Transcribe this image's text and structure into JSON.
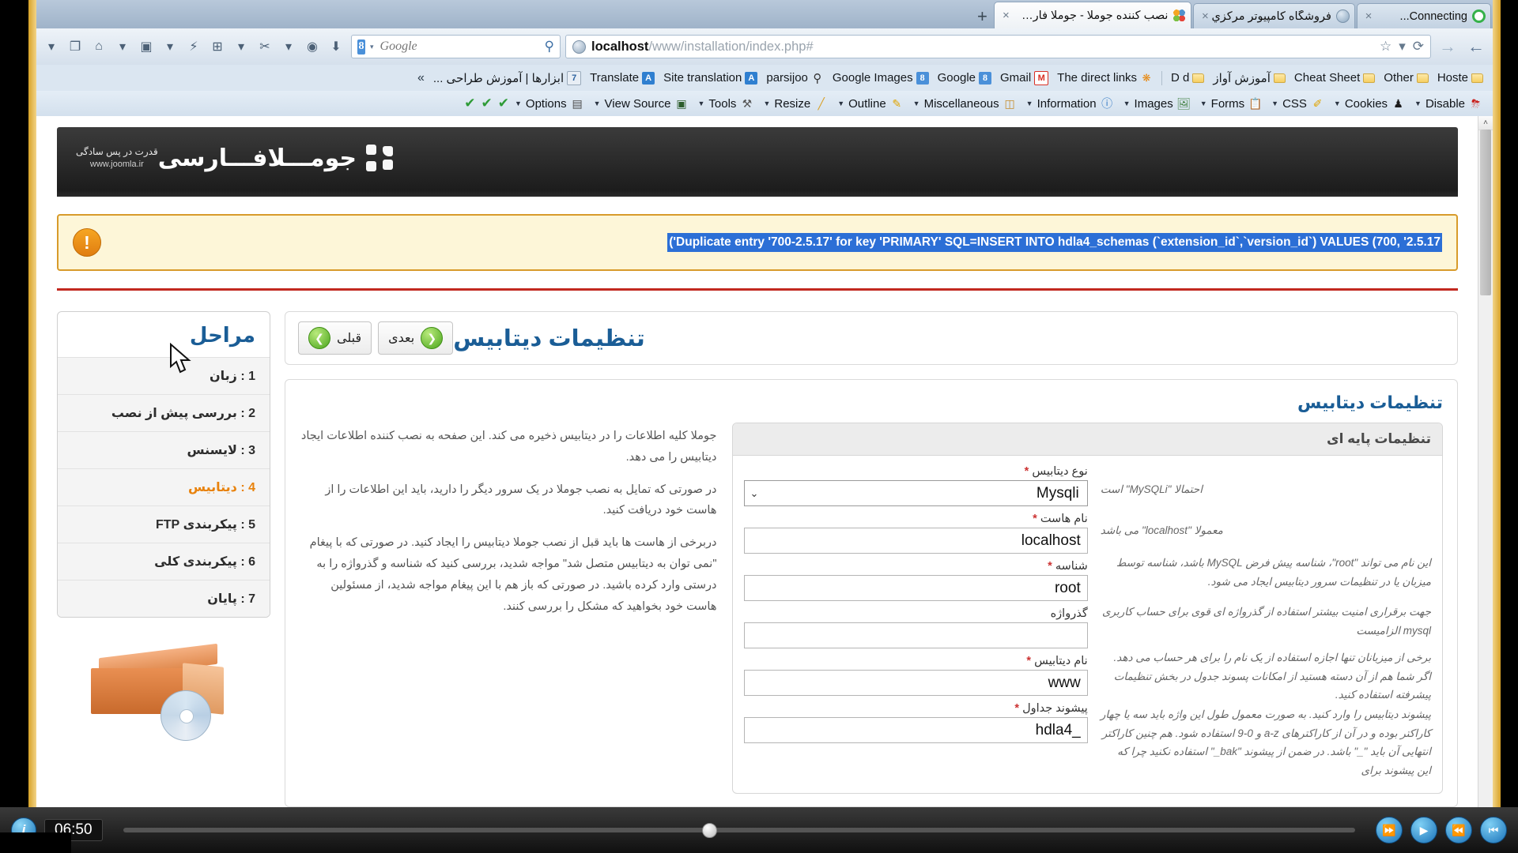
{
  "browser": {
    "tabs": [
      {
        "title": "Connecting...",
        "favicon": "loading-ring-icon",
        "active": false,
        "close": "×"
      },
      {
        "title": "فروشگاه کامپیوتر مرکزي",
        "favicon": "globe-icon",
        "active": false,
        "close": "×"
      },
      {
        "title": "نصب کننده جوملا - جوملا فارس...",
        "favicon": "joomla-icon",
        "active": true,
        "close": "×"
      }
    ],
    "new_tab_label": "+",
    "nav": {
      "back": "←",
      "forward": "→",
      "url_host": "localhost",
      "url_path": "/www/installation/index.php#",
      "bookmark_star": "☆",
      "bookmark_caret": "▾",
      "reload": "⟳",
      "search_engine": "8",
      "search_engine_caret": "▾",
      "search_placeholder": "Google",
      "search_icon": "⚲",
      "download_icon": "⬇",
      "globe_icon": "◉",
      "home_icon": "⌂",
      "toolbar_icons": [
        "▾",
        "✂",
        "▾",
        "⊞",
        "⚡",
        "▾",
        "▣",
        "▾",
        "⌂",
        "❐",
        "▾"
      ]
    },
    "bookmarks": [
      {
        "label": "Hoste",
        "icon": "folder-icon"
      },
      {
        "label": "Other",
        "icon": "folder-icon"
      },
      {
        "label": "Cheat Sheet",
        "icon": "folder-icon"
      },
      {
        "label": "آموزش آواز",
        "icon": "folder-icon"
      },
      {
        "label": "D d",
        "icon": "folder-icon"
      },
      {
        "label": "The direct links",
        "icon": "dots-icon"
      },
      {
        "label": "Gmail",
        "icon": "gmail-icon"
      },
      {
        "label": "Google",
        "icon": "google-icon"
      },
      {
        "label": "Google Images",
        "icon": "google-icon"
      },
      {
        "label": "parsijoo",
        "icon": "search-icon"
      },
      {
        "label": "Site translation",
        "icon": "translate-icon"
      },
      {
        "label": "Translate",
        "icon": "translate-icon"
      },
      {
        "label": "ابزارها | آموزش طراحی ...",
        "icon": "seven-icon"
      }
    ],
    "bookmarks_overflow": "»",
    "webdev_toolbar": [
      {
        "label": "Disable",
        "icon": "disable-icon",
        "glyph": "⊘"
      },
      {
        "label": "Cookies",
        "icon": "cookies-icon",
        "glyph": "♟"
      },
      {
        "label": "CSS",
        "icon": "css-icon",
        "glyph": "✐"
      },
      {
        "label": "Forms",
        "icon": "forms-icon",
        "glyph": "Ὄb"
      },
      {
        "label": "Images",
        "icon": "images-icon",
        "glyph": "Ὓc"
      },
      {
        "label": "Information",
        "icon": "information-icon",
        "glyph": "ℹ"
      },
      {
        "label": "Miscellaneous",
        "icon": "miscellaneous-icon",
        "glyph": "▤"
      },
      {
        "label": "Outline",
        "icon": "outline-icon",
        "glyph": "✎"
      },
      {
        "label": "Resize",
        "icon": "resize-icon",
        "glyph": "╱"
      },
      {
        "label": "Tools",
        "icon": "tools-icon",
        "glyph": "⚒"
      },
      {
        "label": "View Source",
        "icon": "view-source-icon",
        "glyph": "▣"
      },
      {
        "label": "Options",
        "icon": "options-icon",
        "glyph": "☰"
      }
    ],
    "webdev_checks": [
      "✔",
      "✔",
      "✔"
    ],
    "scroll_up_arrow": "˄"
  },
  "joomla": {
    "logo_text": "جومـــلافـــارسی",
    "logo_sub_fa": "قدرت در پس سادگی",
    "logo_sub_url": "www.joomla.ir",
    "alert": {
      "icon": "warning-icon",
      "glyph": "!",
      "message": "('Duplicate entry '700-2.5.17' for key 'PRIMARY' SQL=INSERT INTO hdla4_schemas (`extension_id`,`version_id`) VALUES (700, '2.5.17"
    },
    "page_title": "تنظیمات دیتابیس",
    "buttons": [
      {
        "label": "بعدی",
        "icon": "arrow-left-circle-icon",
        "glyph": "❮"
      },
      {
        "label": "قبلی",
        "icon": "arrow-right-circle-icon",
        "glyph": "❯"
      }
    ],
    "steps_title": "مراحل",
    "steps": [
      {
        "label": "1 : زبان",
        "current": false
      },
      {
        "label": "2 : بررسی پیش از نصب",
        "current": false
      },
      {
        "label": "3 : لایسنس",
        "current": false
      },
      {
        "label": "4 : دیتابیس",
        "current": true
      },
      {
        "label": "5 : پیکربندی FTP",
        "current": false
      },
      {
        "label": "6 : پیکربندی کلی",
        "current": false
      },
      {
        "label": "7 : پایان",
        "current": false
      }
    ],
    "panel_heading": "تنظیمات دیتابیس",
    "description": [
      "جوملا کلیه اطلاعات را در دیتابیس ذخیره می کند. این صفحه به نصب کننده اطلاعات ایجاد دیتابیس را می دهد.",
      "در صورتی که تمایل به نصب جوملا در یک سرور دیگر را دارید، باید این اطلاعات را از هاست خود دریافت کنید.",
      "دربرخی از هاست ها باید قبل از نصب جوملا دیتابیس را ایجاد کنید. در صورتی که با پیغام \"نمی توان به دیتابیس متصل شد\" مواجه شدید، بررسی کنید که شناسه و گذرواژه را به درستی وارد کرده باشید. در صورتی که باز هم با این پیغام مواجه شدید، از مسئولین هاست خود بخواهید که مشکل را بررسی کنند."
    ],
    "form_heading": "تنظیمات پایه ای",
    "fields": [
      {
        "label": "نوع دیتابیس",
        "required": true,
        "type": "select",
        "value": "Mysqli",
        "hint": "احتمالا \"MySQLi\" است"
      },
      {
        "label": "نام هاست",
        "required": true,
        "type": "text",
        "value": "localhost",
        "hint": "معمولا \"localhost\" می باشد"
      },
      {
        "label": "شناسه",
        "required": true,
        "type": "text",
        "value": "root",
        "hint": "این نام می تواند \"root\"، شناسه پیش فرض MySQL باشد، شناسه توسط میزبان یا در تنظیمات سرور دیتابیس ایجاد می شود."
      },
      {
        "label": "گذرواژه",
        "required": false,
        "type": "text",
        "value": "",
        "hint": "جهت برقراری امنیت بیشتر استفاده از گذرواژه ای قوی برای حساب کاربری mysql الزامیست"
      },
      {
        "label": "نام دیتابیس",
        "required": true,
        "type": "text",
        "value": "www",
        "hint": "برخی از میزبانان تنها اجازه استفاده از یک نام را برای هر حساب می دهد. اگر شما هم از آن دسته هستید از امکانات پسوند جدول در بخش تنظیمات پیشرفته استفاده کنید."
      },
      {
        "label": "پیشوند جداول",
        "required": true,
        "type": "text",
        "value": "hdla4_",
        "hint": "پیشوند دیتابیس را وارد کنید. به صورت معمول طول این واژه باید سه یا چهار کاراکتر بوده و در آن از کاراکترهای a-z و 0-9 استفاده شود. هم چنین کاراکتر انتهایی آن باید \"_\" باشد. در ضمن از پیشوند \"bak_\" استفاده نکنید چرا که این پیشوند برای"
      }
    ]
  },
  "player": {
    "buttons": [
      "⏮",
      "⏪",
      "▶",
      "⏩"
    ],
    "time": "06:50",
    "info_glyph": "i"
  }
}
